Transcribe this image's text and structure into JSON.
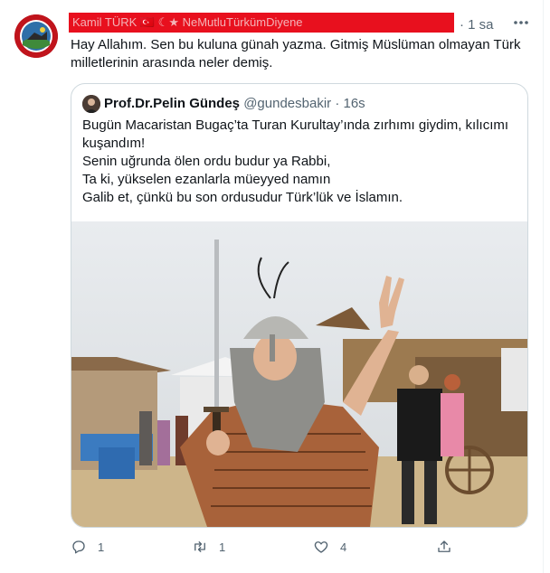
{
  "tweet": {
    "author_redacted": "Kamil TÜRK 🇹🇷 ☾★ NeMutluTürkümDiyene",
    "time": "· 1 sa",
    "text": "Hay Allahım. Sen bu kuluna günah yazma. Gitmiş Müslüman olmayan Türk milletlerinin arasında neler demiş."
  },
  "quote": {
    "name": "Prof.Dr.Pelin Gündeş",
    "handle": "@gundesbakir",
    "dot": "·",
    "time": "16s",
    "lines": [
      "Bugün Macaristan Bugaç’ta Turan Kurultay’ında zırhımı giydim, kılıcımı kuşandım!",
      "Senin uğrunda ölen ordu budur ya Rabbi,",
      "Ta ki, yükselen ezanlarla müeyyed namın",
      "Galib et, çünkü bu son ordusudur Türk’lük ve İslamın."
    ]
  },
  "actions": {
    "reply_count": "1",
    "retweet_count": "1",
    "like_count": "4",
    "share_count": ""
  },
  "icons": [
    "logo-avatar-icon",
    "more-icon",
    "reply-icon",
    "retweet-icon",
    "like-icon",
    "share-icon"
  ],
  "colors": {
    "redaction": "#e8101e",
    "secondary_text": "#536471",
    "border": "#cfd9de"
  }
}
